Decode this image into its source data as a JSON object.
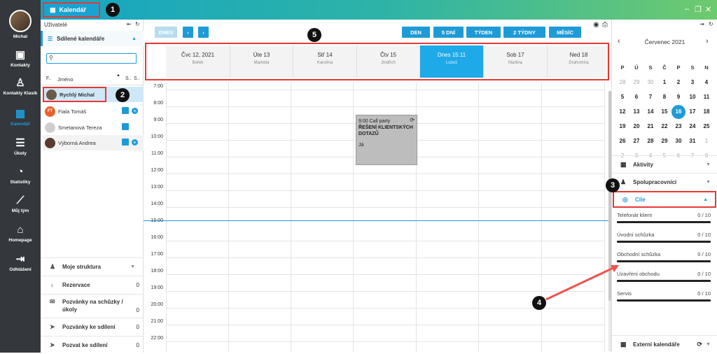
{
  "app": {
    "tab_label": "Kalendář"
  },
  "nav": {
    "user_name": "Michal",
    "items": [
      "Kontakty",
      "Kontakty Klasik",
      "Kalendář",
      "Úkoly",
      "Statistiky",
      "Můj tým",
      "Homepage",
      "Odhlášení"
    ]
  },
  "users_panel": {
    "title": "Uživatelé",
    "shared_calendars": "Sdílené kalendáře",
    "col_f": "F..",
    "col_name": "Jméno",
    "col_s1": "S..",
    "col_s2": "S..",
    "users": [
      {
        "name": "Rychlý Michal",
        "initials": ""
      },
      {
        "name": "Fiala Tomáš",
        "initials": "FT"
      },
      {
        "name": "Smetanová Tereza",
        "initials": ""
      },
      {
        "name": "Výborná Andrea",
        "initials": ""
      }
    ],
    "sections": [
      {
        "label": "Moje struktura",
        "count": ""
      },
      {
        "label": "Rezervace",
        "count": "0"
      },
      {
        "label": "Pozvánky na schůzky / úkoly",
        "count": "0"
      },
      {
        "label": "Pozvánky ke sdílení",
        "count": "0"
      },
      {
        "label": "Pozvat ke sdílení",
        "count": "0"
      }
    ]
  },
  "toolbar": {
    "today": "DNES",
    "views": [
      "DEN",
      "5 DNÍ",
      "TÝDEN",
      "2 TÝDNY",
      "MĚSÍC"
    ]
  },
  "days": [
    {
      "label": "Čvc 12, 2021",
      "name": "Bořek"
    },
    {
      "label": "Úte 13",
      "name": "Markéta"
    },
    {
      "label": "Stř 14",
      "name": "Karolína"
    },
    {
      "label": "Čtv 15",
      "name": "Jindřich"
    },
    {
      "label": "Dnes 15:11",
      "name": "Luboš"
    },
    {
      "label": "Sob 17",
      "name": "Martina"
    },
    {
      "label": "Ned 18",
      "name": "Drahomíra"
    }
  ],
  "hours": [
    "7:00",
    "8:00",
    "9:00",
    "10:00",
    "11:00",
    "12:00",
    "13:00",
    "14:00",
    "15:00",
    "16:00",
    "17:00",
    "18:00",
    "19:00",
    "20:00",
    "21:00",
    "22:00"
  ],
  "event": {
    "time_title": "9:00 Call party",
    "subject": "ŘEŠENÍ KLIENTSKÝCH DOTAZŮ",
    "who": "Já"
  },
  "mini_calendar": {
    "month": "Červenec 2021",
    "weekdays": [
      "P",
      "Ú",
      "S",
      "Č",
      "P",
      "S",
      "N"
    ],
    "weeks": [
      [
        "28",
        "29",
        "30",
        "1",
        "2",
        "3",
        "4"
      ],
      [
        "5",
        "6",
        "7",
        "8",
        "9",
        "10",
        "11"
      ],
      [
        "12",
        "13",
        "14",
        "15",
        "16",
        "17",
        "18"
      ],
      [
        "19",
        "20",
        "21",
        "22",
        "23",
        "24",
        "25"
      ],
      [
        "26",
        "27",
        "28",
        "29",
        "30",
        "31",
        "1"
      ],
      [
        "2",
        "3",
        "4",
        "5",
        "6",
        "7",
        "8"
      ]
    ],
    "today": "16"
  },
  "right_sections": {
    "activities": "Aktivity",
    "collaborators": "Spolupracovníci",
    "goals": "Cíle",
    "external": "Externí kalendáře"
  },
  "goals": [
    {
      "label": "Telefonát klient",
      "value": "0 / 10"
    },
    {
      "label": "Úvodní schůzka",
      "value": "0 / 10"
    },
    {
      "label": "Obchodní schůzka",
      "value": "0 / 10"
    },
    {
      "label": "Uzavření obchodu",
      "value": "0 / 10"
    },
    {
      "label": "Servis",
      "value": "0 / 10"
    }
  ],
  "callouts": [
    "1",
    "2",
    "3",
    "4",
    "5"
  ],
  "colors": {
    "accent": "#1e9bd7",
    "nav_bg": "#34383c",
    "highlight": "#e53935"
  }
}
